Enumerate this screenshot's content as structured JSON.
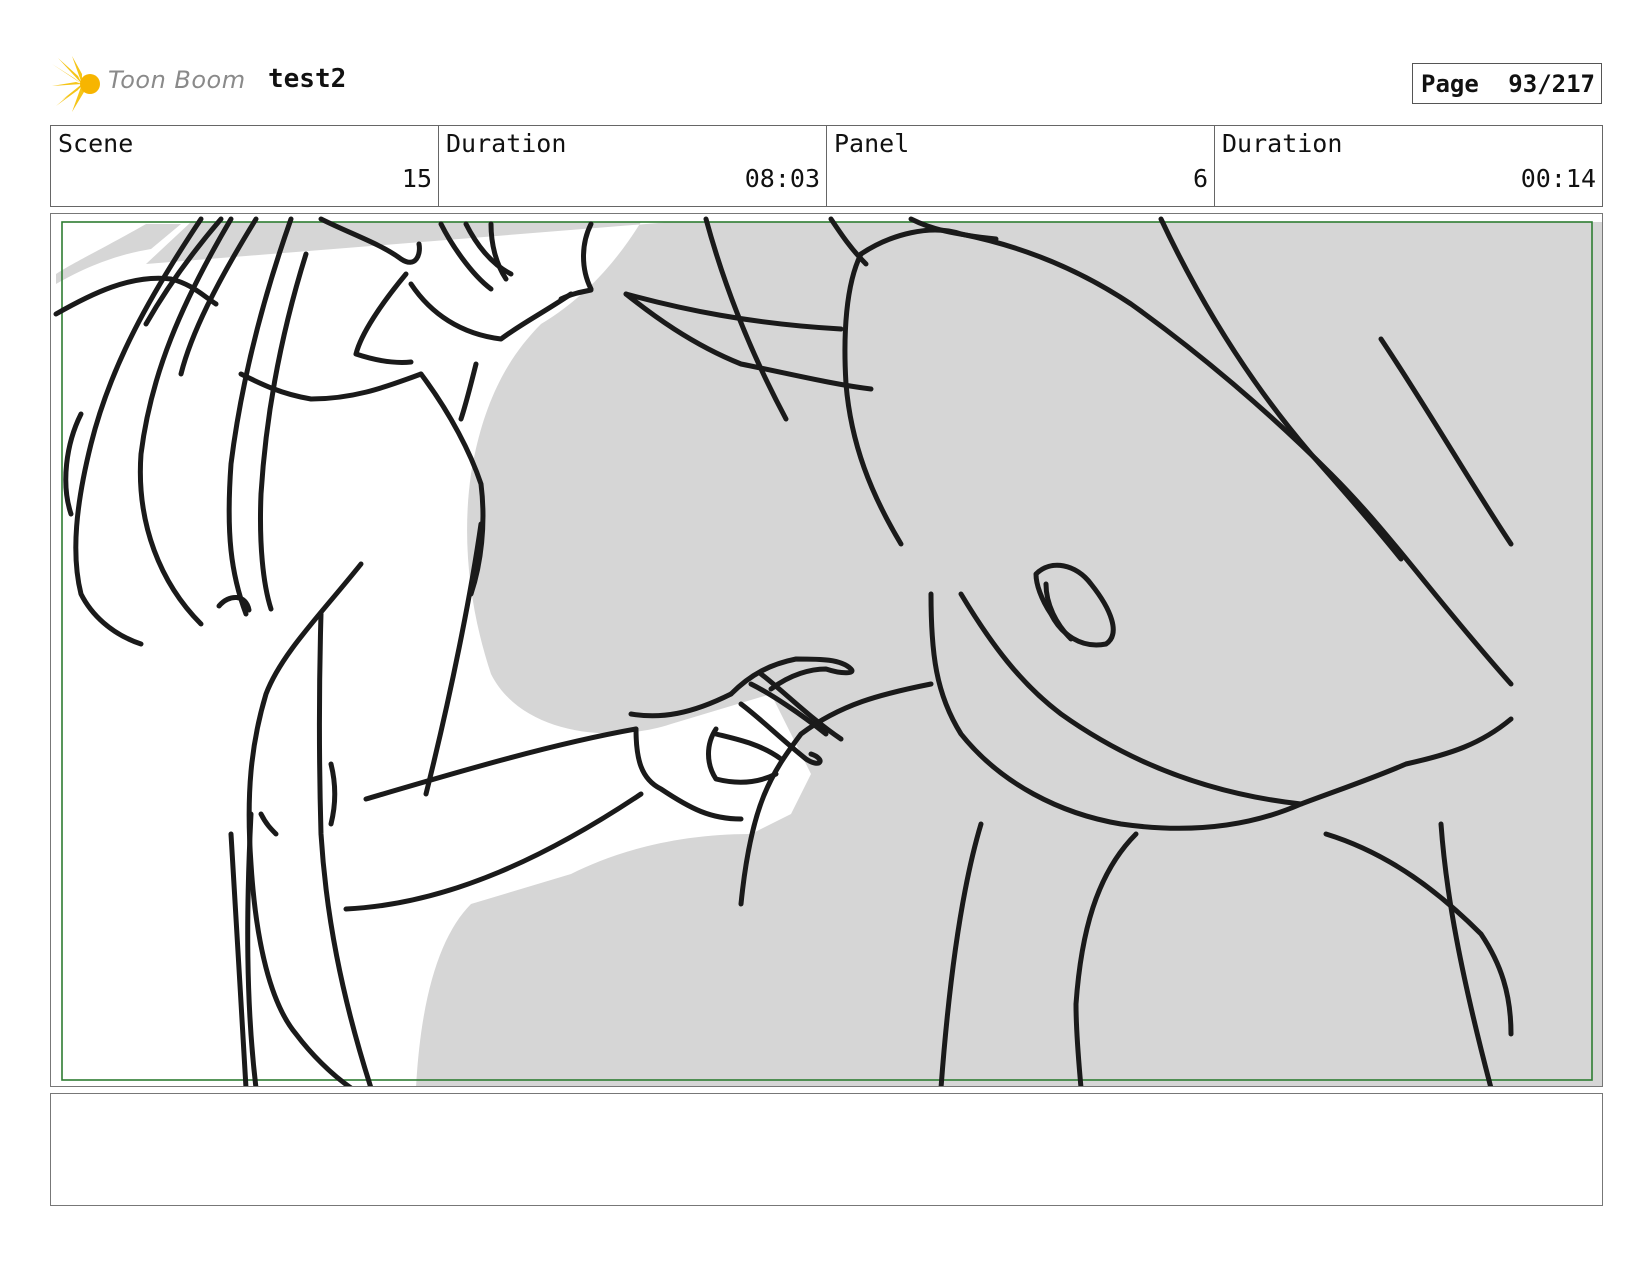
{
  "header": {
    "logo_text": "Toon Boom",
    "project_title": "test2",
    "page_label": "Page",
    "page_value": "93/217"
  },
  "info": {
    "scene_label": "Scene",
    "scene_value": "15",
    "scene_duration_label": "Duration",
    "scene_duration_value": "08:03",
    "panel_label": "Panel",
    "panel_value": "6",
    "panel_duration_label": "Duration",
    "panel_duration_value": "00:14"
  },
  "notes": {
    "text": ""
  },
  "colors": {
    "safe_area_border": "#2e7d32",
    "background_fill": "#d6d6d6",
    "line_color": "#1a1a1a",
    "logo_accent": "#f5c518"
  }
}
